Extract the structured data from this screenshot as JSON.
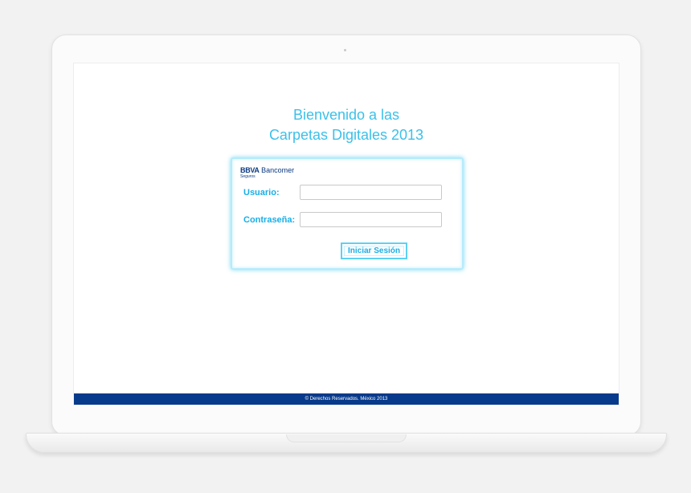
{
  "welcome": {
    "line1": "Bienvenido a las",
    "line2": "Carpetas Digitales 2013"
  },
  "brand": {
    "bold": "BBVA",
    "name": " Bancomer",
    "sub": "Seguros"
  },
  "form": {
    "user_label": "Usuario:",
    "user_value": "",
    "user_placeholder": "",
    "password_label": "Contraseña:",
    "password_value": "",
    "password_placeholder": "",
    "submit_label": "Iniciar Sesión"
  },
  "footer": {
    "text": "© Derechos Reservados. México 2013"
  },
  "colors": {
    "accent": "#3cc0ea",
    "brand_blue": "#073a8a",
    "label_blue": "#1aaee6"
  }
}
